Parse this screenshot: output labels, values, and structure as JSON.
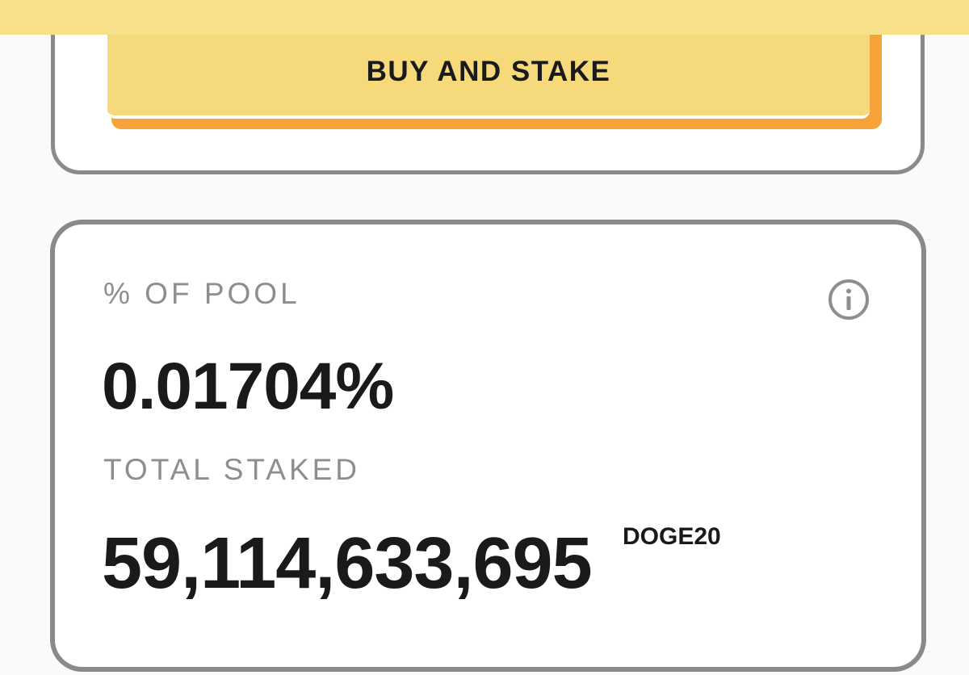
{
  "buy_card": {
    "button_label": "BUY AND STAKE"
  },
  "pool_card": {
    "pool_label": "% OF POOL",
    "pool_value": "0.01704%",
    "staked_label": "TOTAL STAKED",
    "staked_value": "59,114,633,695",
    "staked_unit": "DOGE20",
    "info_icon": "info-icon"
  },
  "colors": {
    "banner": "#f8e08a",
    "button": "#f5d97a",
    "button_shadow": "#f6a43a",
    "card_border": "#8a8a8a",
    "label_text": "#8e8e8e",
    "value_text": "#1a1a1a"
  }
}
